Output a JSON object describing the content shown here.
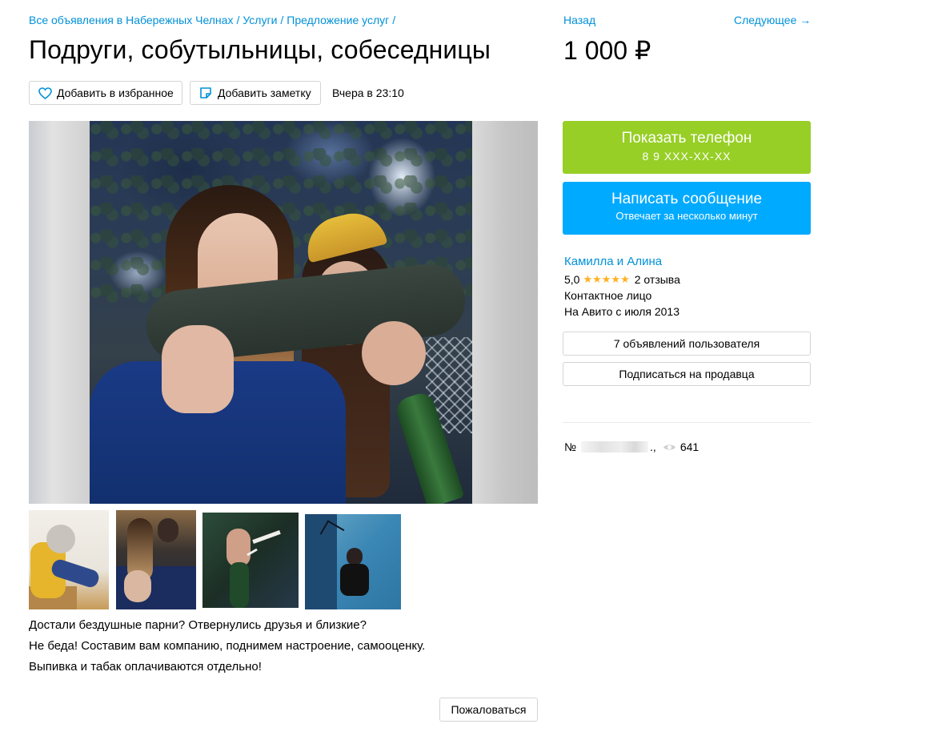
{
  "breadcrumb": {
    "items": [
      "Все объявления в Набережных Челнах",
      "Услуги",
      "Предложение услуг"
    ],
    "separator": "/"
  },
  "nav": {
    "back": "Назад",
    "next": "Следующее →"
  },
  "listing": {
    "title": "Подруги, собутыльницы, собеседницы",
    "price": "1 000 ₽",
    "posted": "Вчера в 23:10"
  },
  "actions": {
    "favorite": "Добавить в избранное",
    "note": "Добавить заметку",
    "report": "Пожаловаться"
  },
  "contact_buttons": {
    "show_phone": "Показать телефон",
    "phone_masked": "8 9     XXX-XX-XX",
    "write_message": "Написать сообщение",
    "reply_time": "Отвечает за несколько минут"
  },
  "seller": {
    "name": "Камилла и Алина",
    "rating": "5,0",
    "stars": "★★★★★",
    "reviews": "2 отзыва",
    "role": "Контактное лицо",
    "since": "На Авито с июля 2013",
    "ads_button": "7 объявлений пользователя",
    "subscribe_button": "Подписаться на продавца"
  },
  "meta": {
    "number_prefix": "№",
    "number_suffix": ".",
    "separator": ",",
    "views": "641"
  },
  "description": [
    "Достали бездушные парни? Отвернулись друзья и близкие?",
    "Не беда! Составим вам компанию, поднимем настроение, самооценку.",
    "Выпивка и табак оплачиваются отдельно!"
  ],
  "colors": {
    "link": "#0091d9",
    "show_phone_bg": "#97cf26",
    "write_message_bg": "#00aaff",
    "star": "#ffb021"
  },
  "icons": {
    "favorite": "heart-icon",
    "note": "note-icon",
    "views": "eye-icon"
  }
}
